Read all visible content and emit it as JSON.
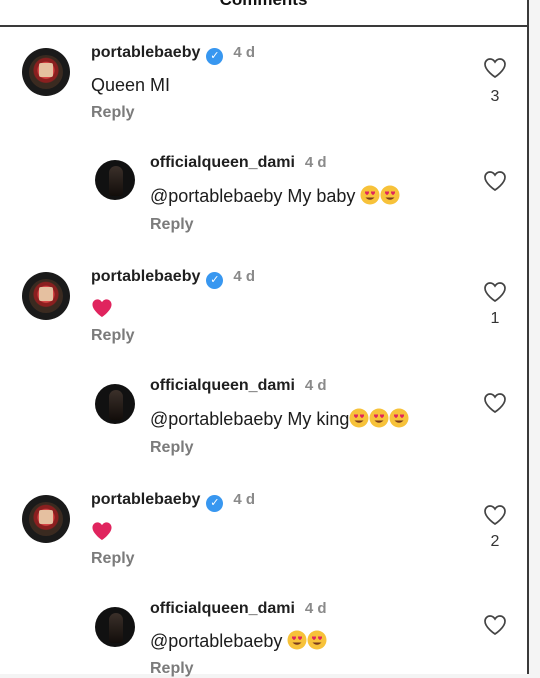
{
  "header": {
    "title": "Comments"
  },
  "reply_label": "Reply",
  "comments": [
    {
      "username": "portablebaeby",
      "time": "4 d",
      "text": "Queen MI",
      "likes": "3"
    },
    {
      "username": "officialqueen_dami",
      "time": "4 d",
      "text": "@portablebaeby My baby",
      "emoji_count": 2
    },
    {
      "username": "portablebaeby",
      "time": "4 d",
      "text": "",
      "likes": "1"
    },
    {
      "username": "officialqueen_dami",
      "time": "4 d",
      "text": "@portablebaeby My king",
      "emoji_count": 3
    },
    {
      "username": "portablebaeby",
      "time": "4 d",
      "text": "",
      "likes": "2"
    },
    {
      "username": "officialqueen_dami",
      "time": "4 d",
      "text": "@portablebaeby",
      "emoji_count": 2
    }
  ],
  "icons": {
    "verified": "verified-badge-icon",
    "like": "heart-outline-icon",
    "emoji": "smiling-face-with-heart-eyes-emoji",
    "heart_emoji": "red-heart-emoji"
  },
  "colors": {
    "verified": "#3897f0",
    "muted": "#8a8a8a",
    "heart": "#e0245e"
  }
}
